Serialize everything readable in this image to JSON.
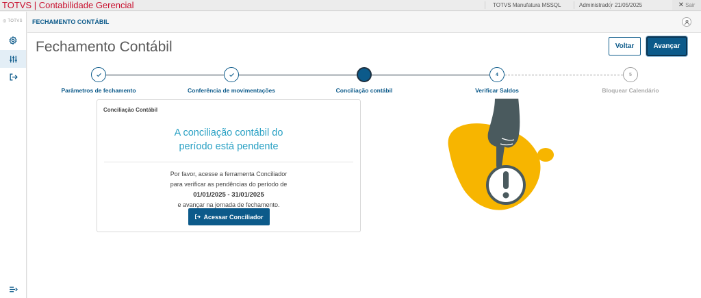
{
  "app": {
    "title": "TOTVS | Contabilidade Gerencial",
    "environment": "TOTVS Manufatura MSSQL",
    "user": "Administrador",
    "date": "21/05/2025",
    "exit_label": "Sair",
    "logo_text": "TOTVS"
  },
  "header": {
    "section_title": "FECHAMENTO CONTÁBIL"
  },
  "page": {
    "title": "Fechamento Contábil",
    "back_label": "Voltar",
    "next_label": "Avançar"
  },
  "stepper": {
    "steps": [
      {
        "label": "Parâmetros de fechamento",
        "number": "1",
        "status": "done"
      },
      {
        "label": "Conferência de movimentações",
        "number": "2",
        "status": "done"
      },
      {
        "label": "Conciliação contábil",
        "number": "3",
        "status": "current"
      },
      {
        "label": "Verificar Saldos",
        "number": "4",
        "status": "next"
      },
      {
        "label": "Bloquear Calendário",
        "number": "5",
        "status": "disabled"
      }
    ]
  },
  "card": {
    "title": "Conciliação Contábil",
    "heading_line1": "A conciliação contábil do",
    "heading_line2": "período está pendente",
    "body_line1": "Por favor, acesse a ferramenta Conciliador",
    "body_line2": "para verificar as pendências do período de",
    "period": "01/01/2025 - 31/01/2025",
    "body_line3": "e avançar na jornada de fechamento.",
    "button_label": "Acessar Conciliador"
  },
  "colors": {
    "brand_red": "#c8102e",
    "primary": "#0c5a8a",
    "accent_text": "#2aa1c4",
    "illustration_yellow": "#f7b500",
    "illustration_hand": "#4a5a5e"
  }
}
